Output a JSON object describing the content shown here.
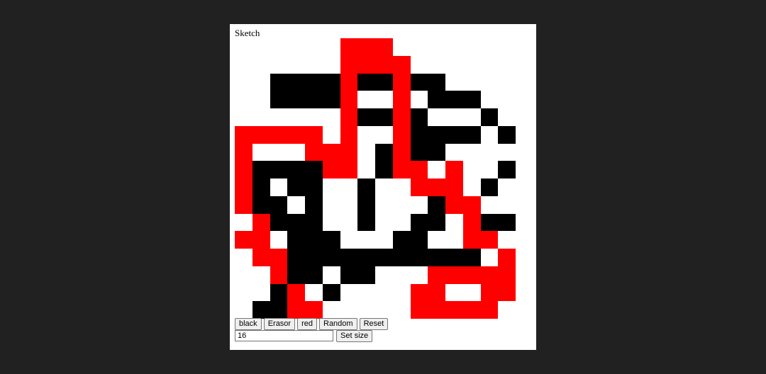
{
  "app": {
    "title": "Sketch"
  },
  "grid": {
    "size": 16,
    "colors": {
      "W": "#ffffff",
      "K": "#000000",
      "R": "#ff0000"
    },
    "rows": [
      "WWWWWWRRRWWWWWWW",
      "WWWWWWRRRRWWWWWW",
      "WWKKKKRKKRKKWWWW",
      "WWKKKKRWWRWKKKWW",
      "WWWWWWRKKRKWWWKW",
      "RRRRRWRWWRKKKKWK",
      "RWWWRRRWKRKKWWWW",
      "RKKKKRRWKRRWRWWK",
      "RKWKKWWKWWRRRWKW",
      "RKKWKWWKWWWKRRWW",
      "WRKKKWWKWWKKWRKK",
      "RRWKKKWWWKKWWRRW",
      "WRRKKKKKKKKKKKWR",
      "WWRKKWKKWWWRRRRR",
      "WWKRWKWWWWRRWWRR",
      "WKKRRWWWWWRRRRRW"
    ]
  },
  "controls": {
    "black_label": "black",
    "eraser_label": "Erasor",
    "red_label": "red",
    "random_label": "Random",
    "reset_label": "Reset",
    "size_value": "16",
    "set_size_label": "Set size"
  }
}
